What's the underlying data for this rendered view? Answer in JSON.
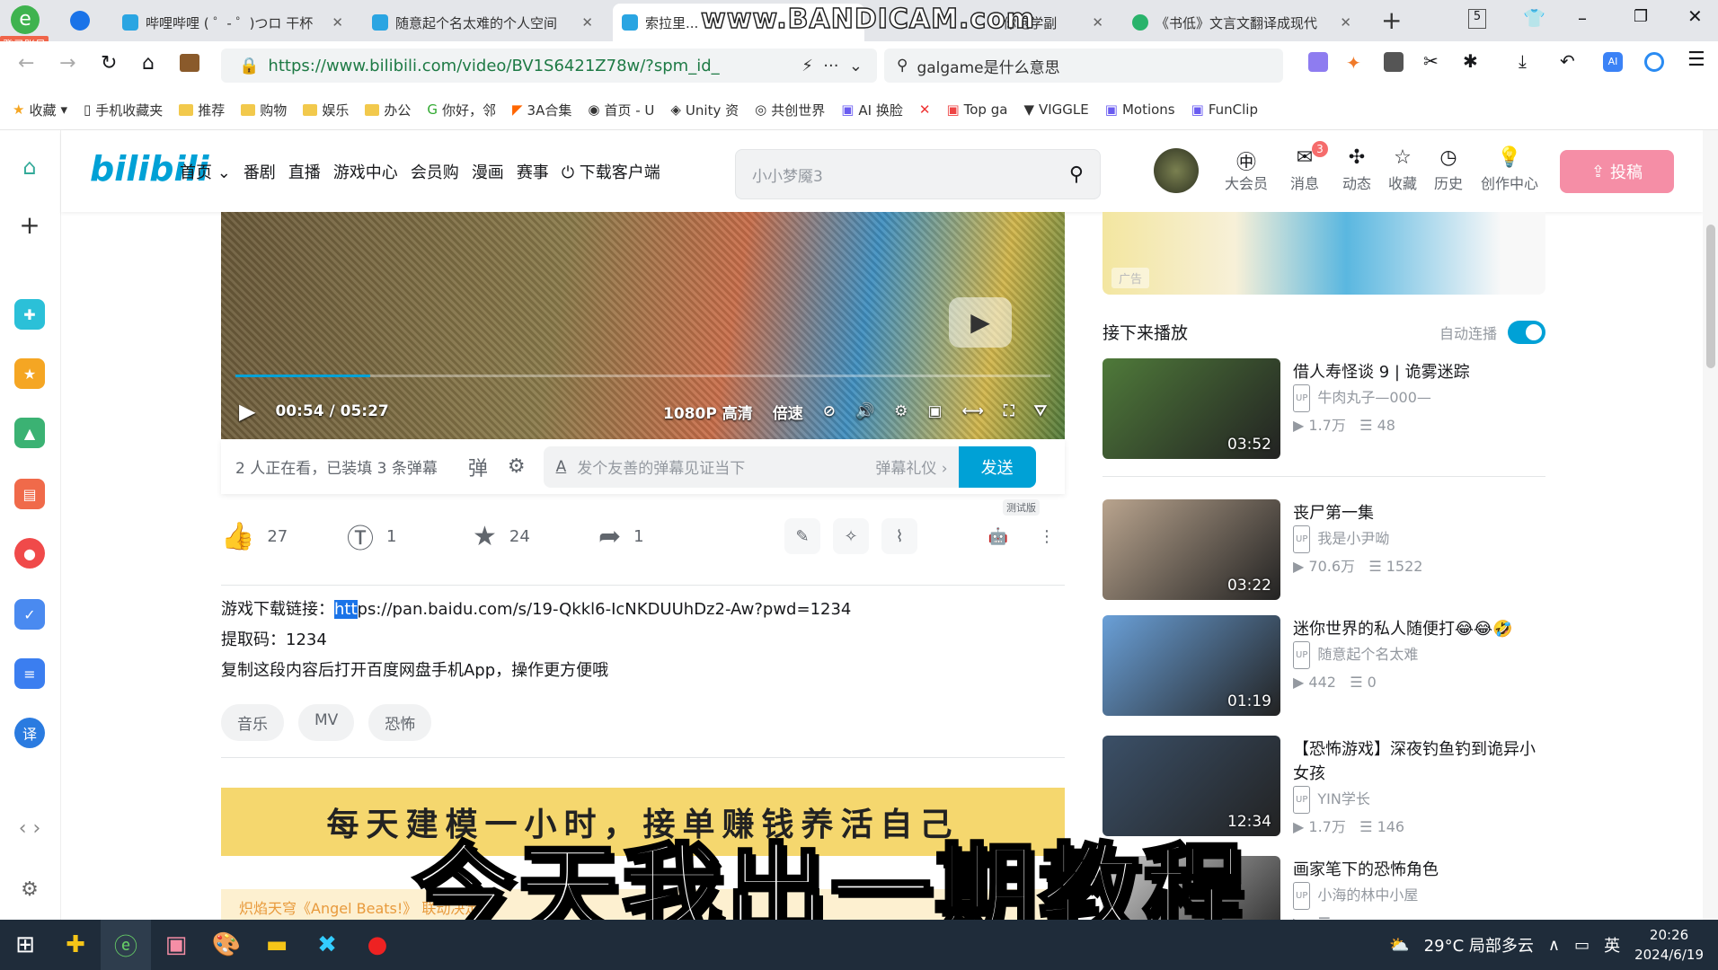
{
  "browser": {
    "tabs": [
      {
        "title": "哔哩哔哩 ( ゜- ゜)つロ 干杯"
      },
      {
        "title": "随意起个名太难的个人空间"
      },
      {
        "title": "索拉里..."
      },
      {
        "title": "...你跑学副"
      },
      {
        "title": "《书低》文言文翻译成现代"
      }
    ],
    "tab_count": "5",
    "login_badge": "登录账号",
    "url": "https://www.bilibili.com/video/BV1S6421Z78w/?spm_id_",
    "search_value": "galgame是什么意思",
    "bookmarks": [
      "收藏",
      "手机收藏夹",
      "推荐",
      "购物",
      "娱乐",
      "办公",
      "你好，邻",
      "3A合集",
      "首页 - U",
      "Unity 资",
      "共创世界",
      "AI 换脸",
      "Top ga",
      "VIGGLE",
      "Motions",
      "FunClip"
    ]
  },
  "watermark": "www.BANDICAM.com",
  "site": {
    "logo": "bilibili",
    "nav": [
      "首页",
      "番剧",
      "直播",
      "游戏中心",
      "会员购",
      "漫画",
      "赛事",
      "下载客户端"
    ],
    "search_placeholder": "小小梦魇3",
    "header_icons": [
      {
        "label": "大会员",
        "icon": "vip-icon"
      },
      {
        "label": "消息",
        "icon": "message-icon"
      },
      {
        "label": "动态",
        "icon": "dynamic-icon"
      },
      {
        "label": "收藏",
        "icon": "favorite-icon"
      },
      {
        "label": "历史",
        "icon": "history-icon"
      },
      {
        "label": "创作中心",
        "icon": "creator-icon"
      }
    ],
    "message_badge": "3",
    "upload_label": "投稿"
  },
  "player": {
    "current_time": "00:54",
    "duration": "05:27",
    "time_sep": " / ",
    "progress": 0.165,
    "quality": "1080P 高清",
    "speed": "倍速"
  },
  "danmaku": {
    "status": "2 人正在看，已装填 3 条弹幕",
    "placeholder": "发个友善的弹幕见证当下",
    "etiquette": "弹幕礼仪 ›",
    "send": "发送",
    "beta": "测试版"
  },
  "actions": {
    "like": "27",
    "coin": "1",
    "favorite": "24",
    "share": "1"
  },
  "description": {
    "line1_label": "游戏下载链接：",
    "line1_sel": "htt",
    "line1_rest": "ps://pan.baidu.com/s/19-Qkkl6-IcNKDUUhDz2-Aw?pwd=1234",
    "line2": "提取码：1234",
    "line3": "复制这段内容后打开百度网盘手机App，操作更方便哦"
  },
  "tags": [
    "音乐",
    "MV",
    "恐怖"
  ],
  "banner": {
    "text": "每天建模一小时，接单赚钱养活自己",
    "sub": "炽焰天穹《Angel Beats!》 联动决定"
  },
  "ad_label": "广告",
  "next": {
    "header": "接下来播放",
    "autoplay_label": "自动连播",
    "autoplay": true,
    "items": [
      {
        "title": "借人寿怪谈 9 | 诡雾迷踪",
        "up": "牛肉丸子—000—",
        "views": "1.7万",
        "danmaku": "48",
        "duration": "03:52",
        "color": "#4f7a3a"
      },
      {
        "title": "丧尸第一集",
        "up": "我是小尹呦",
        "views": "70.6万",
        "danmaku": "1522",
        "duration": "03:22",
        "color": "#b9a48e"
      },
      {
        "title": "迷你世界的私人随便打😂😂🤣",
        "up": "随意起个名太难",
        "views": "442",
        "danmaku": "0",
        "duration": "01:19",
        "color": "#6aa0d8"
      },
      {
        "title": "【恐怖游戏】深夜钓鱼钓到诡异小女孩",
        "up": "YIN学长",
        "views": "1.7万",
        "danmaku": "146",
        "duration": "12:34",
        "color": "#3b5068"
      },
      {
        "title": "画家笔下的恐怖角色",
        "up": "小海的林中小屋",
        "views": "",
        "danmaku": "",
        "duration": "",
        "color": "#cfcfcf"
      }
    ]
  },
  "subtitle": "今天我出一期教程",
  "taskbar": {
    "weather": "29°C 局部多云",
    "ime": "英",
    "time": "20:26",
    "date": "2024/6/19"
  }
}
